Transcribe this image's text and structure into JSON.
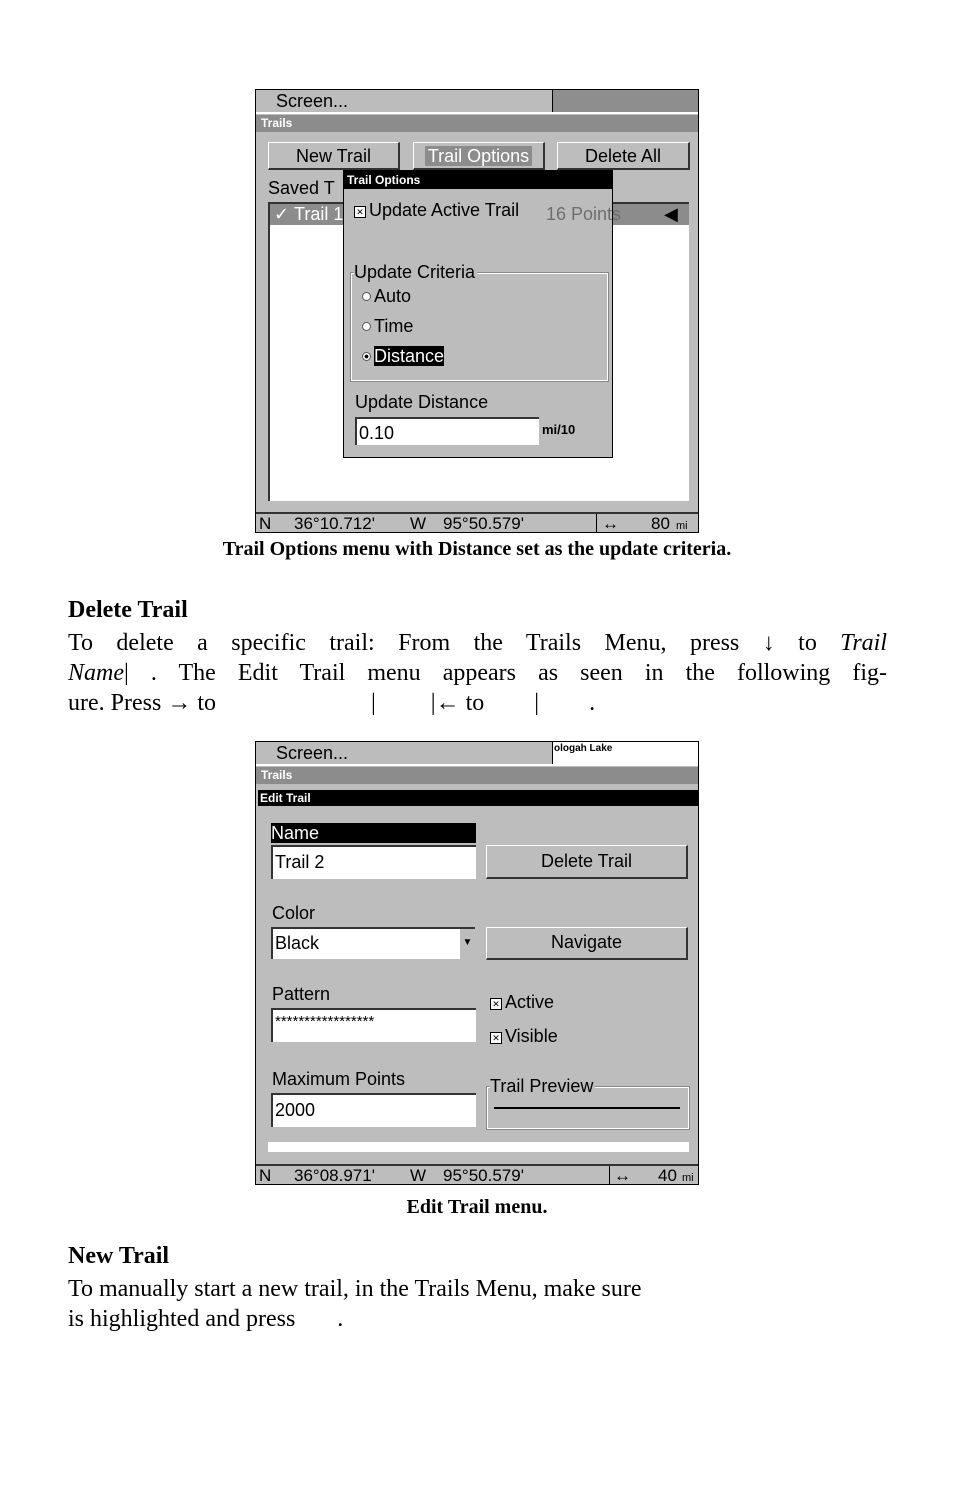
{
  "figure1": {
    "top_bar": "Screen...",
    "section_bar": "Trails",
    "buttons": {
      "new_trail": "New Trail",
      "trail_options": "Trail Options",
      "delete_all": "Delete All"
    },
    "saved_label": "Saved T",
    "list_row": {
      "check": "✓",
      "name": "Trail 1",
      "points": "16 Points",
      "arrow": "◀"
    },
    "dialog": {
      "title": "Trail Options",
      "update_active_trail": {
        "label": "Update Active Trail",
        "checked": true
      },
      "criteria_label": "Update Criteria",
      "criteria_options": [
        "Auto",
        "Time",
        "Distance"
      ],
      "criteria_selected": "Distance",
      "distance_label": "Update Distance",
      "distance_value": "0.10",
      "distance_unit": "mi/10"
    },
    "status": {
      "lat_hemi": "N",
      "lat": "36°10.712'",
      "lon_hemi": "W",
      "lon": "95°50.579'",
      "zoom_icon": "↔",
      "zoom": "80",
      "unit": "mi"
    },
    "caption": "Trail Options menu with Distance set as the update criteria."
  },
  "delete_section": {
    "heading": "Delete Trail",
    "line1": "To delete a specific trail: From the Trails Menu, press ↓ to",
    "line1_italic": "Trail",
    "line2_italic": "Name",
    "line2": "|      . The Edit Trail menu appears as seen in the following fig-",
    "line3a": "ure. Press → to",
    "line3b": "|",
    "line3c": "|← to",
    "line3d": "|",
    "line3e": "."
  },
  "figure2": {
    "top_bar": "Screen...",
    "map_label": "ologah Lake",
    "section_bar": "Trails",
    "title": "Edit Trail",
    "name_label": "Name",
    "name_value": "Trail 2",
    "delete_button": "Delete Trail",
    "color_label": "Color",
    "color_value": "Black",
    "navigate_button": "Navigate",
    "pattern_label": "Pattern",
    "pattern_value": "*****************",
    "active": {
      "label": "Active",
      "checked": true
    },
    "visible": {
      "label": "Visible",
      "checked": true
    },
    "max_points_label": "Maximum Points",
    "max_points_value": "2000",
    "preview_label": "Trail Preview",
    "status": {
      "lat_hemi": "N",
      "lat": "36°08.971'",
      "lon_hemi": "W",
      "lon": "95°50.579'",
      "zoom_icon": "↔",
      "zoom": "40",
      "unit": "mi"
    },
    "caption": "Edit Trail menu."
  },
  "new_section": {
    "heading": "New Trail",
    "line1": "To manually start a new trail, in the Trails Menu, make sure",
    "line2": "is highlighted and press       ."
  }
}
